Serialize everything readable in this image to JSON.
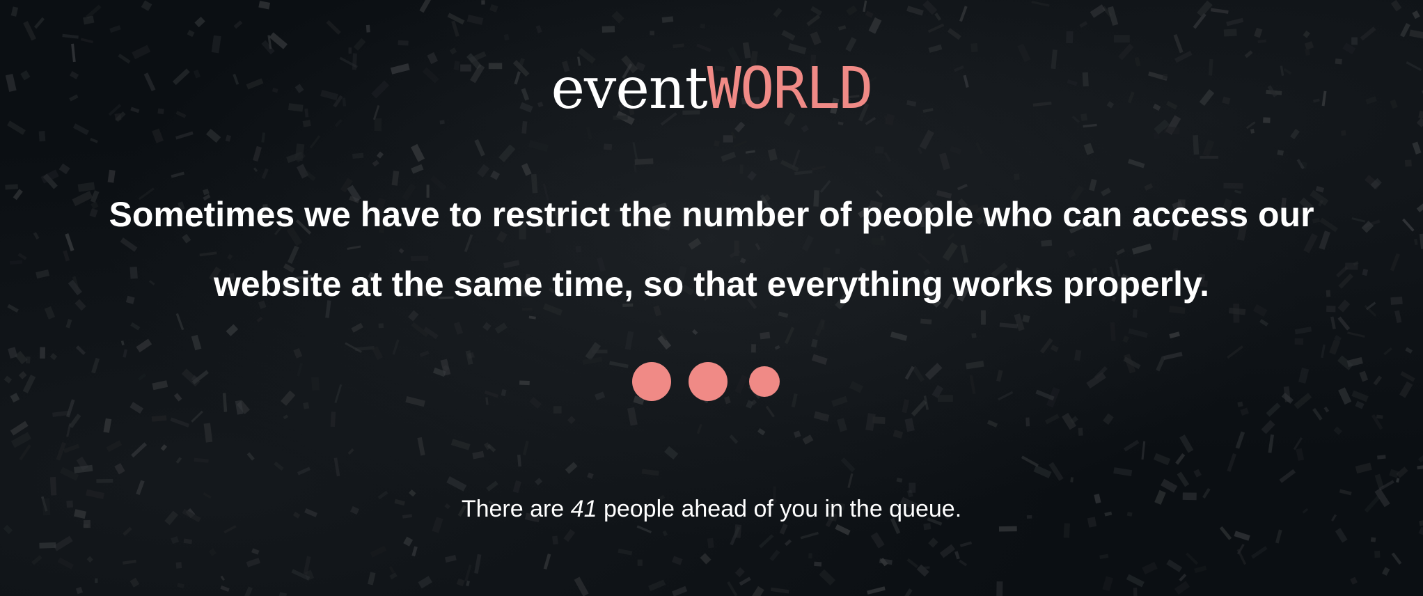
{
  "brand": {
    "logo_part1": "event",
    "logo_part2": "WORLD",
    "accent_color": "#f08a86"
  },
  "message": {
    "headline_line1": "Sometimes we have to restrict the number of people who can access our",
    "headline_line2": "website at the same time, so that everything works properly."
  },
  "loader": {
    "icon": "loading-dots-icon"
  },
  "queue": {
    "prefix": "There are ",
    "count": "41",
    "suffix": " people ahead of you in the queue."
  }
}
